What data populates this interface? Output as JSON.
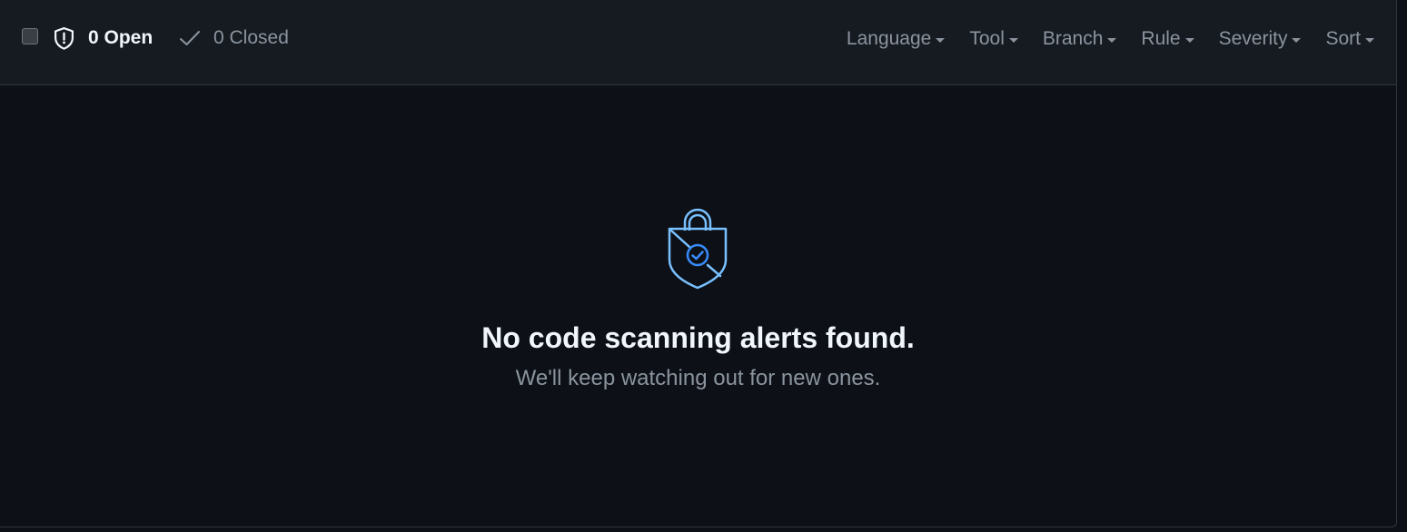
{
  "header": {
    "tabs": {
      "open_label": "0 Open",
      "closed_label": "0 Closed"
    },
    "filters": [
      {
        "label": "Language"
      },
      {
        "label": "Tool"
      },
      {
        "label": "Branch"
      },
      {
        "label": "Rule"
      },
      {
        "label": "Severity"
      },
      {
        "label": "Sort"
      }
    ]
  },
  "empty_state": {
    "icon": "shield-check-icon",
    "title": "No code scanning alerts found.",
    "subtitle": "We'll keep watching out for new ones."
  },
  "colors": {
    "background": "#0d1117",
    "header_background": "#161b22",
    "border": "#30363d",
    "text_primary": "#f0f6fc",
    "text_muted": "#8b949e",
    "accent_blue": "#58a6ff",
    "accent_blue_light": "#79c0ff"
  }
}
